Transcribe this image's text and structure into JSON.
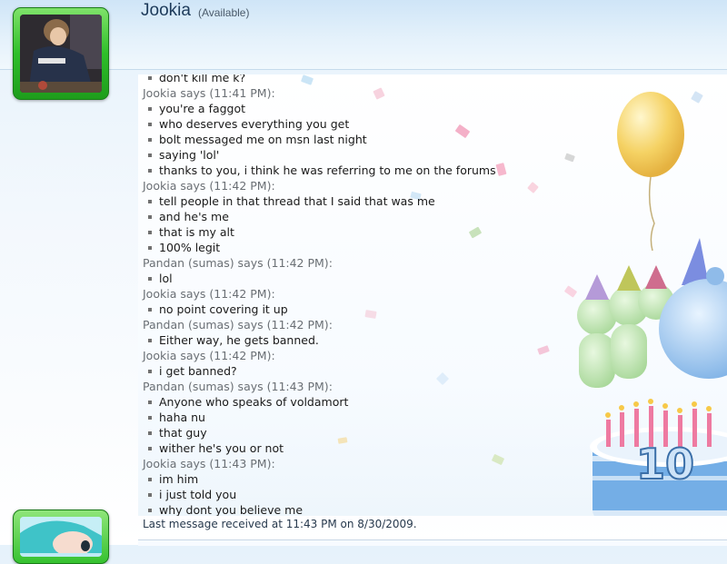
{
  "contact": {
    "name": "Jookia",
    "status": "(Available)"
  },
  "chat": {
    "entries": [
      {
        "kind": "msg",
        "text": "don't kill me k?"
      },
      {
        "kind": "says",
        "text": "Jookia says (11:41 PM):"
      },
      {
        "kind": "msg",
        "text": "you're a faggot"
      },
      {
        "kind": "msg",
        "text": "who deserves everything you get"
      },
      {
        "kind": "msg",
        "text": "bolt messaged me on msn last night"
      },
      {
        "kind": "msg",
        "text": "saying 'lol'"
      },
      {
        "kind": "msg",
        "text": "thanks to you, i think he was referring to me on the forums"
      },
      {
        "kind": "says",
        "text": "Jookia says (11:42 PM):"
      },
      {
        "kind": "msg",
        "text": "tell people in that thread that I said that was me"
      },
      {
        "kind": "msg",
        "text": "and he's me"
      },
      {
        "kind": "msg",
        "text": "that is my alt"
      },
      {
        "kind": "msg",
        "text": "100% legit"
      },
      {
        "kind": "says",
        "text": "Pandan (sumas) says (11:42 PM):"
      },
      {
        "kind": "msg",
        "text": "lol"
      },
      {
        "kind": "says",
        "text": "Jookia says (11:42 PM):"
      },
      {
        "kind": "msg",
        "text": "no point covering it up"
      },
      {
        "kind": "says",
        "text": "Pandan (sumas) says (11:42 PM):"
      },
      {
        "kind": "msg",
        "text": "Either way, he gets banned."
      },
      {
        "kind": "says",
        "text": "Jookia says (11:42 PM):"
      },
      {
        "kind": "msg",
        "text": "i get banned?"
      },
      {
        "kind": "says",
        "text": "Pandan (sumas) says (11:43 PM):"
      },
      {
        "kind": "msg",
        "text": "Anyone who speaks of voldamort"
      },
      {
        "kind": "msg",
        "text": "haha nu"
      },
      {
        "kind": "msg",
        "text": "that guy"
      },
      {
        "kind": "msg",
        "text": "wither he's you or not"
      },
      {
        "kind": "says",
        "text": "Jookia says (11:43 PM):"
      },
      {
        "kind": "msg",
        "text": "im him"
      },
      {
        "kind": "msg",
        "text": "i just told you"
      },
      {
        "kind": "msg",
        "text": "why dont you believe me"
      }
    ],
    "status_line": "Last message received at 11:43 PM on 8/30/2009."
  },
  "decor": {
    "cake_number": "10",
    "theme": "birthday-10-anniversary",
    "colors": {
      "avatar_frame": "#2fbf2a",
      "balloon": "#f3c94a",
      "cake": "#6fa8e3",
      "candle": "#ef6f9a"
    }
  }
}
